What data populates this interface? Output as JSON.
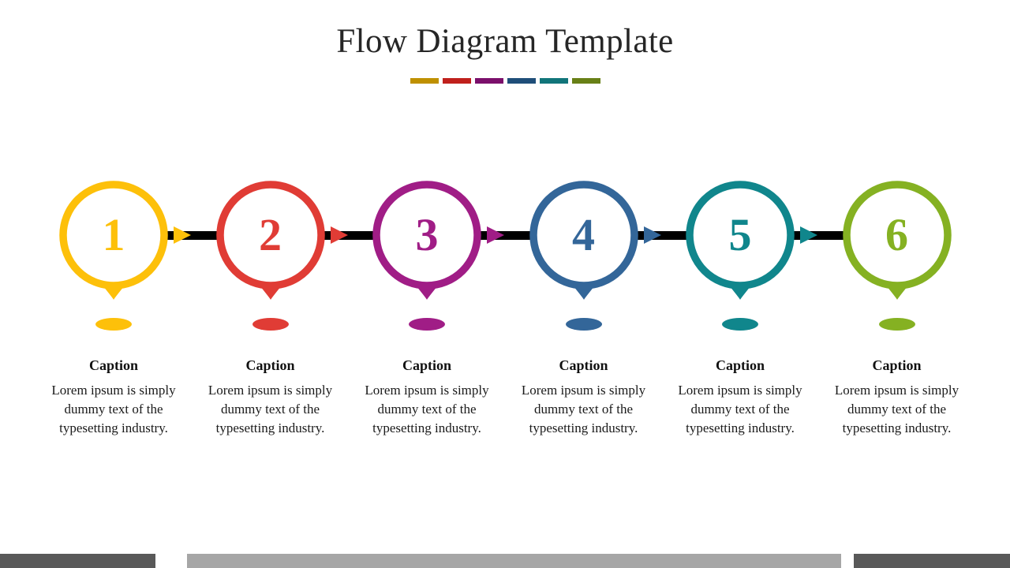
{
  "slide": {
    "background_color": "#ffffff",
    "title": "Flow Diagram Template"
  },
  "divider": {
    "segments": [
      {
        "name": "divider-segment-gold",
        "color": "#bf9000"
      },
      {
        "name": "divider-segment-red",
        "color": "#c0201c"
      },
      {
        "name": "divider-segment-purple",
        "color": "#7b0f6b"
      },
      {
        "name": "divider-segment-blue",
        "color": "#1f4e79"
      },
      {
        "name": "divider-segment-teal",
        "color": "#11757a"
      },
      {
        "name": "divider-segment-olive",
        "color": "#688016"
      }
    ]
  },
  "connector_line_color": "#000000",
  "flow": {
    "steps": [
      {
        "number": "1",
        "color": "#fdc00a",
        "caption_title": "Caption",
        "caption_body": "Lorem ipsum is simply dummy text of the typesetting industry.",
        "has_arrow_after": true
      },
      {
        "number": "2",
        "color": "#e03c35",
        "caption_title": "Caption",
        "caption_body": "Lorem ipsum is simply dummy text of the typesetting industry.",
        "has_arrow_after": true
      },
      {
        "number": "3",
        "color": "#a01d86",
        "caption_title": "Caption",
        "caption_body": "Lorem ipsum is simply dummy text of the typesetting industry.",
        "has_arrow_after": true
      },
      {
        "number": "4",
        "color": "#336699",
        "caption_title": "Caption",
        "caption_body": "Lorem ipsum is simply dummy text of the typesetting industry.",
        "has_arrow_after": true
      },
      {
        "number": "5",
        "color": "#10868c",
        "caption_title": "Caption",
        "caption_body": "Lorem ipsum is simply dummy text of the typesetting industry.",
        "has_arrow_after": true
      },
      {
        "number": "6",
        "color": "#85b122",
        "caption_title": "Caption",
        "caption_body": "Lorem ipsum is simply dummy text of the typesetting industry.",
        "has_arrow_after": false
      }
    ]
  },
  "scrollbar": {
    "track_color": "#ffffff",
    "end_color": "#595959",
    "thumb_color": "#a6a6a6"
  }
}
